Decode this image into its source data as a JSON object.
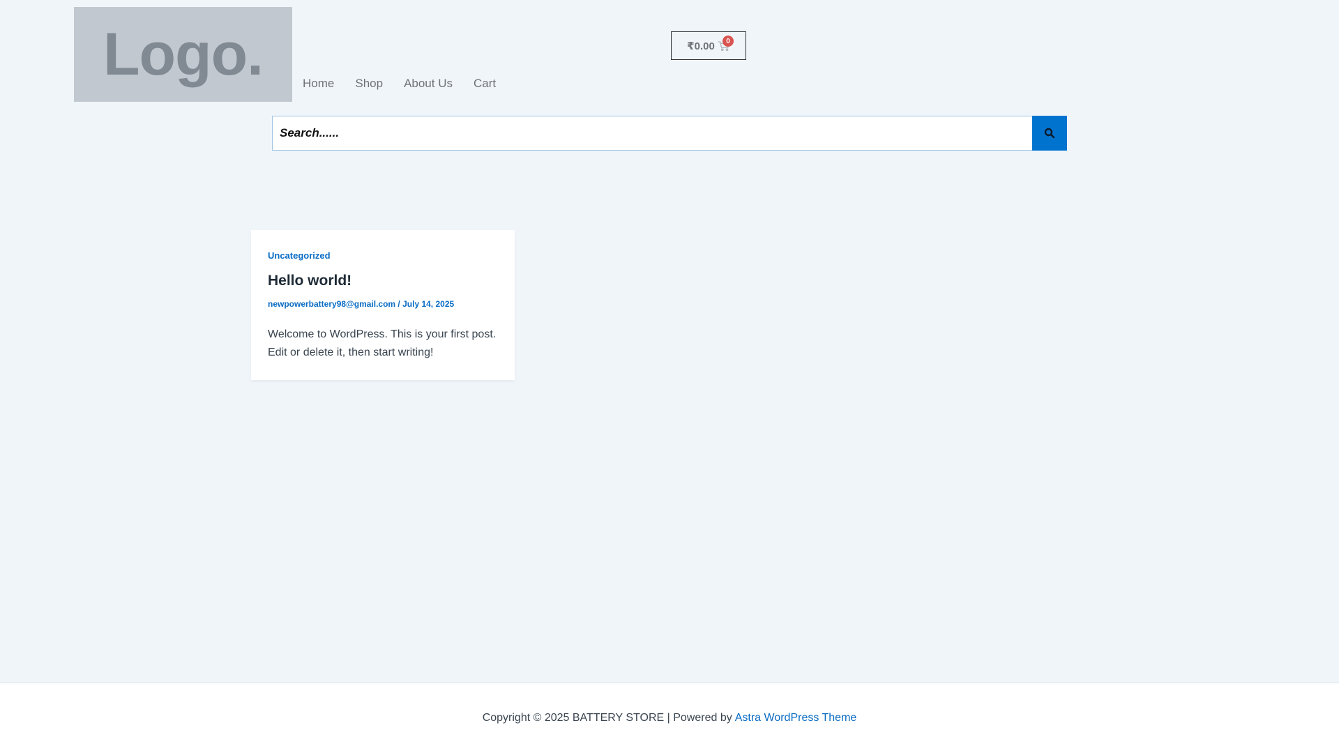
{
  "header": {
    "logo_text": "Logo.",
    "nav": [
      {
        "label": "Home"
      },
      {
        "label": "Shop"
      },
      {
        "label": "About Us"
      },
      {
        "label": "Cart"
      }
    ],
    "cart": {
      "total": "₹0.00",
      "count": "0",
      "icon": "shopping-cart-icon"
    }
  },
  "search": {
    "placeholder": "Search......",
    "button_icon": "search-icon"
  },
  "post": {
    "category": "Uncategorized",
    "title": "Hello world!",
    "author": "newpowerbattery98@gmail.com",
    "separator": " / ",
    "date": "July 14, 2025",
    "excerpt": "Welcome to WordPress. This is your first post. Edit or delete it, then start writing!"
  },
  "footer": {
    "copyright": "Copyright © 2025 BATTERY STORE | Powered by",
    "theme_link": "Astra WordPress Theme"
  },
  "colors": {
    "page_bg": "#f0f5fa",
    "accent": "#0073cf",
    "badge": "#d9534f",
    "logo_bg": "#c2c8cf"
  }
}
